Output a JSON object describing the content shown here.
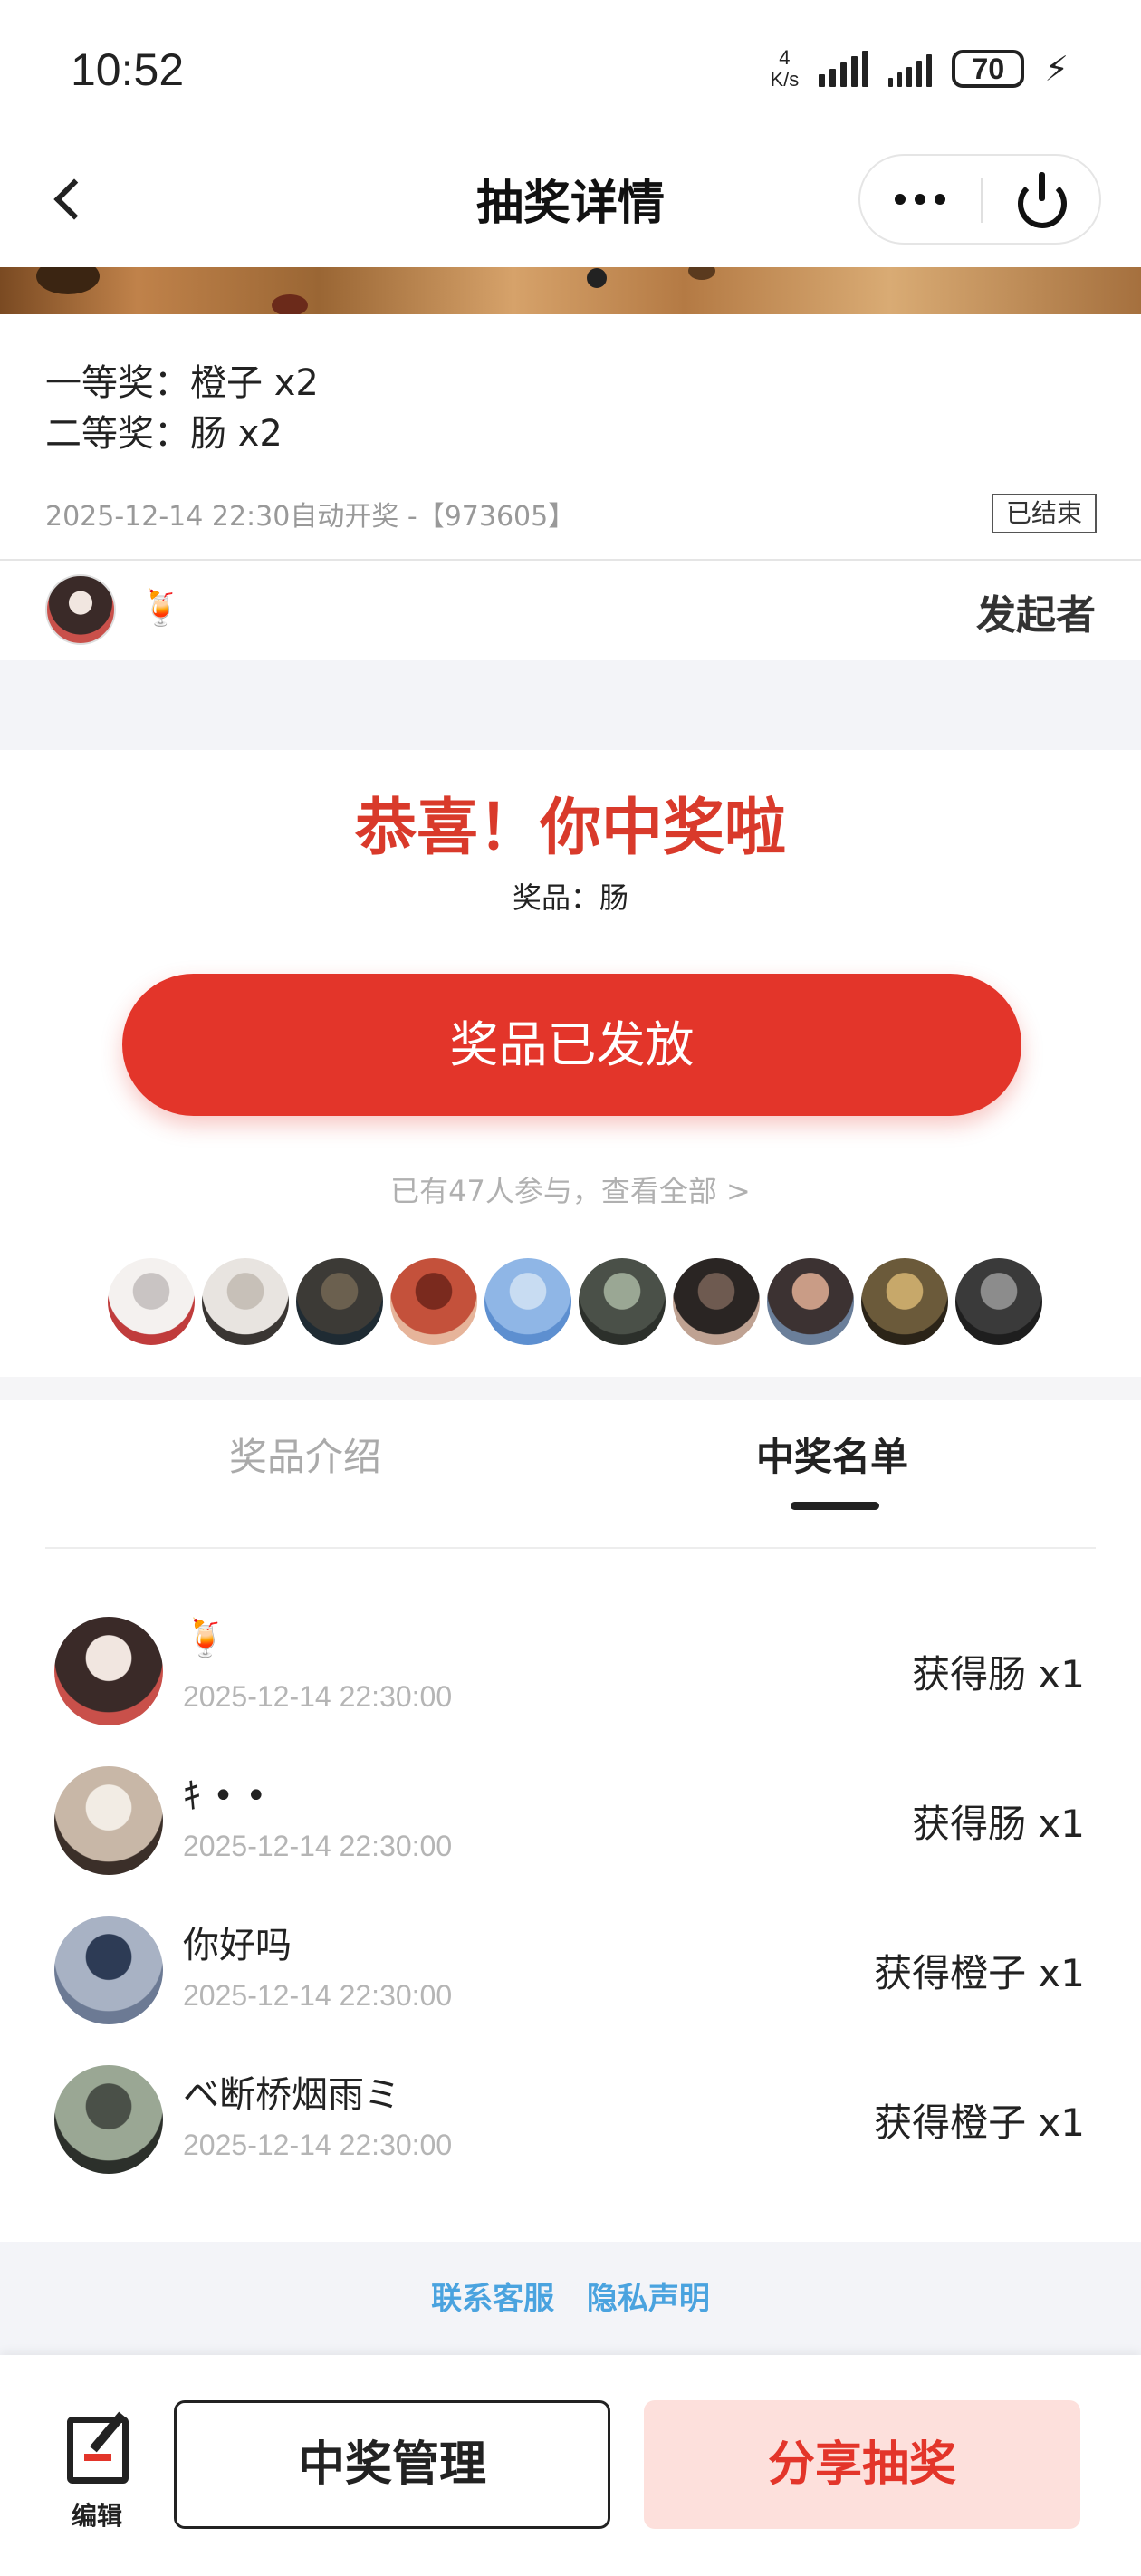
{
  "status_bar": {
    "time": "10:52",
    "net_speed_value": "4",
    "net_speed_unit": "K/s",
    "battery": "70"
  },
  "nav": {
    "title": "抽奖详情",
    "more_icon": "more-dots-icon",
    "power_icon": "power-icon"
  },
  "lottery": {
    "prizes": [
      "一等奖：橙子 x2",
      "二等奖：肠 x2"
    ],
    "meta": "2025-12-14 22:30自动开奖 -【973605】",
    "status_badge": "已结束"
  },
  "initiator": {
    "emoji": "🍹",
    "label": "发起者"
  },
  "result": {
    "congrats": "恭喜！你中奖啦",
    "prize_line": "奖品：肠",
    "button": "奖品已发放",
    "participants": "已有47人参与，查看全部 >"
  },
  "participant_avatars": [
    {
      "colors": [
        "#f4f1ef",
        "#c9c4c3",
        "#c03c3c"
      ]
    },
    {
      "colors": [
        "#e8e4e0",
        "#c7c0b8",
        "#3a3633"
      ]
    },
    {
      "colors": [
        "#3c3a36",
        "#6b604f",
        "#1f2b33"
      ]
    },
    {
      "colors": [
        "#c4513b",
        "#7a2a1e",
        "#e6b49a"
      ]
    },
    {
      "colors": [
        "#8fb6e6",
        "#c8dcf2",
        "#5d8fd0"
      ]
    },
    {
      "colors": [
        "#4a5048",
        "#9aa794",
        "#2c302b"
      ]
    },
    {
      "colors": [
        "#2a2523",
        "#6e5a50",
        "#bfa292"
      ]
    },
    {
      "colors": [
        "#3c3232",
        "#c99c86",
        "#6b7f9a"
      ]
    },
    {
      "colors": [
        "#6b5a3a",
        "#c7a86a",
        "#2b2418"
      ]
    },
    {
      "colors": [
        "#3a3a3a",
        "#8c8c8c",
        "#1e1e1e"
      ]
    }
  ],
  "tabs": {
    "intro": "奖品介绍",
    "winners": "中奖名单"
  },
  "winners": [
    {
      "name": "🍹",
      "time": "2025-12-14 22:30:00",
      "prize": "获得肠 x1",
      "colors": [
        "#f1e6e0",
        "#3a2a28",
        "#c9504a"
      ]
    },
    {
      "name": "ｷ • •",
      "time": "2025-12-14 22:30:00",
      "prize": "获得肠 x1",
      "colors": [
        "#f2ece4",
        "#c8b7a7",
        "#3b2f29"
      ]
    },
    {
      "name": "你好吗",
      "time": "2025-12-14 22:30:00",
      "prize": "获得橙子 x1",
      "colors": [
        "#2d3b55",
        "#a8b2c4",
        "#6c7a94"
      ]
    },
    {
      "name": "ベ断桥烟雨ミ",
      "time": "2025-12-14 22:30:00",
      "prize": "获得橙子 x1",
      "colors": [
        "#4a5048",
        "#9aa794",
        "#2c302b"
      ]
    }
  ],
  "footer": {
    "contact": "联系客服",
    "privacy": "隐私声明"
  },
  "bottom_bar": {
    "edit_label": "编辑",
    "manage": "中奖管理",
    "share": "分享抽奖",
    "edit_icon": "edit-icon"
  },
  "colors": {
    "accent": "#e3352a",
    "accent_light": "#fde0dc",
    "link": "#4aa3df",
    "muted": "#999999"
  }
}
